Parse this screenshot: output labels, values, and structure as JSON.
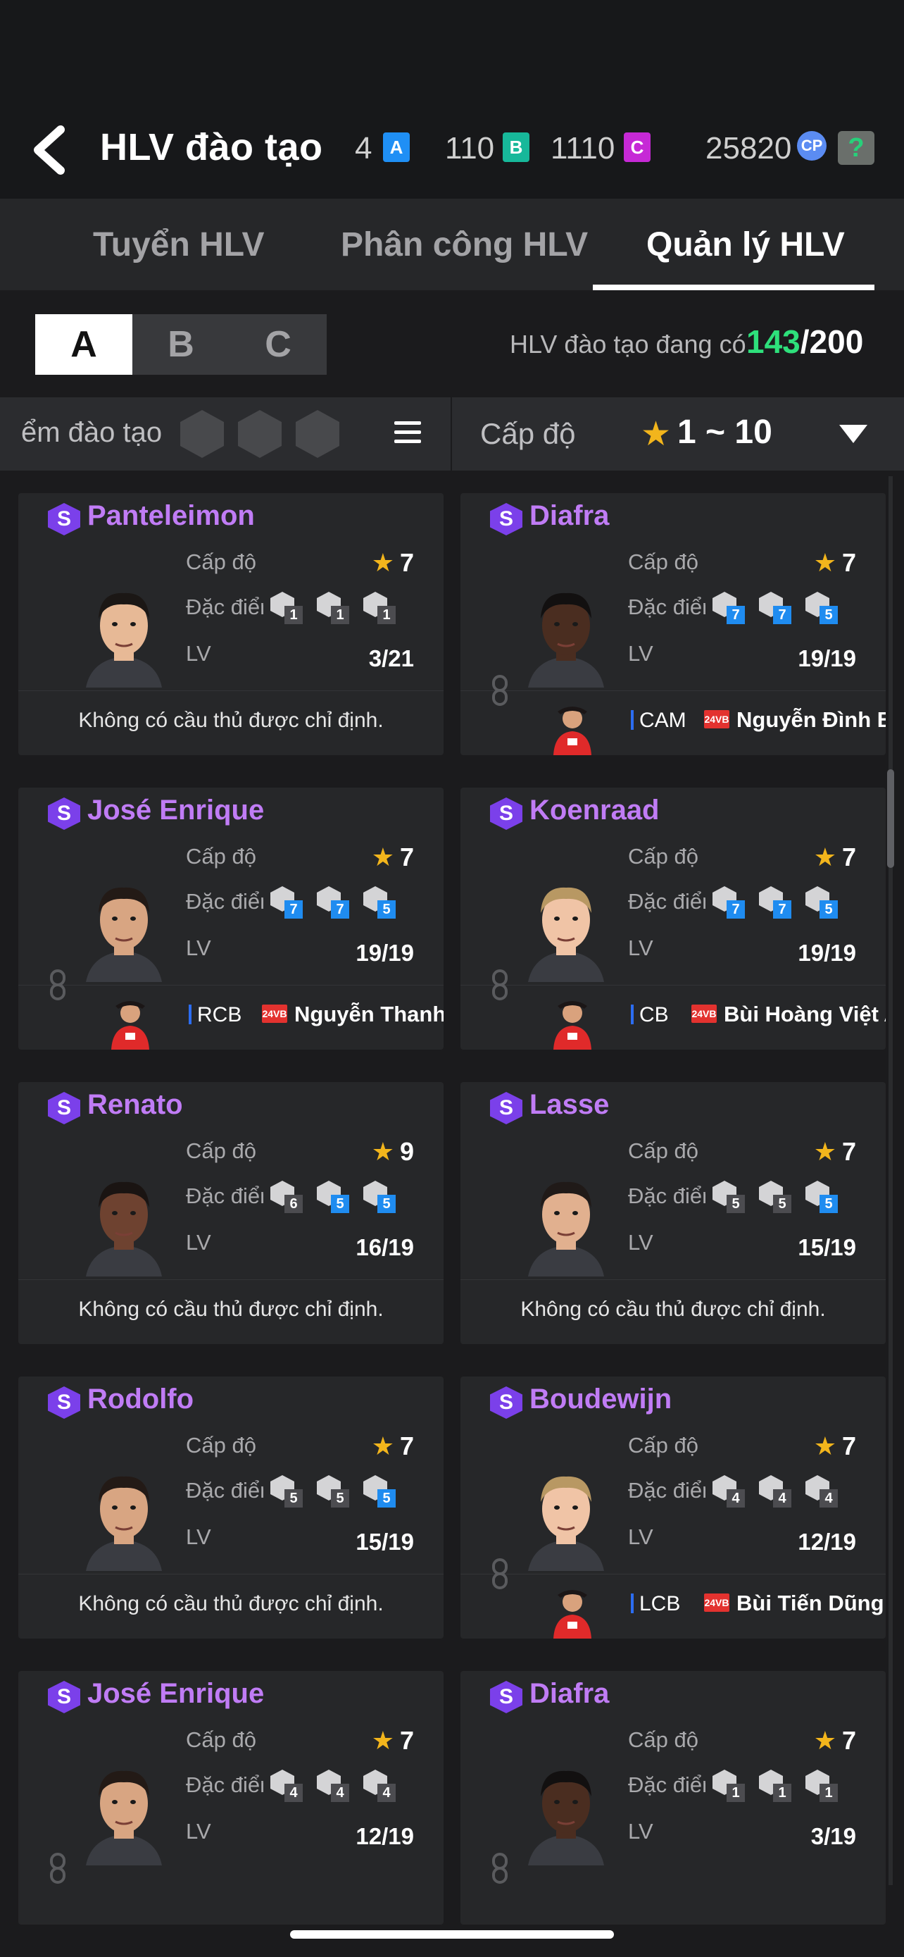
{
  "header": {
    "title": "HLV đào tạo",
    "currencies": [
      {
        "value": "4",
        "letter": "A",
        "color": "#1f8ff5"
      },
      {
        "value": "110",
        "letter": "B",
        "color": "#17b89a"
      },
      {
        "value": "1110",
        "letter": "C",
        "color": "#c629d6"
      }
    ],
    "cp_value": "25820",
    "cp_icon": "CP",
    "help_icon": "?"
  },
  "tabs": [
    {
      "label": "Tuyển HLV"
    },
    {
      "label": "Phân công HLV"
    },
    {
      "label": "Quản lý HLV",
      "active": true
    }
  ],
  "segments": [
    "A",
    "B",
    "C"
  ],
  "coach_count": {
    "label": "HLV đào tạo đang có",
    "current": "143",
    "max": "/200"
  },
  "filter": {
    "left_label": "ểm đào tạo",
    "level_label": "Cấp độ",
    "level_star": "★",
    "level_range": "1 ~ 10"
  },
  "labels": {
    "level": "Cấp độ",
    "trait": "Đặc điểm",
    "lv": "LV",
    "star": "★",
    "s": "S",
    "tag": "24VB"
  },
  "cards": [
    {
      "name": "Panteleimon",
      "level": "7",
      "lv": "3/21",
      "traits": [
        "1",
        "1",
        "1"
      ],
      "blue": [
        false,
        false,
        false
      ],
      "none": "Không có cầu thủ được chỉ định.",
      "skin": "#e7b996",
      "hair": "#1b1715"
    },
    {
      "name": "Diafra",
      "level": "7",
      "lv": "19/19",
      "traits": [
        "7",
        "7",
        "5"
      ],
      "blue": [
        true,
        true,
        true
      ],
      "pos": "CAM",
      "player": "Nguyễn Đình Bắc",
      "skin": "#4a2d20",
      "hair": "#121010"
    },
    {
      "name": "José Enrique",
      "level": "7",
      "lv": "19/19",
      "traits": [
        "7",
        "7",
        "5"
      ],
      "blue": [
        true,
        true,
        true
      ],
      "pos": "RCB",
      "player": "Nguyễn Thanh Bình",
      "skin": "#d8a582",
      "hair": "#231a16"
    },
    {
      "name": "Koenraad",
      "level": "7",
      "lv": "19/19",
      "traits": [
        "7",
        "7",
        "5"
      ],
      "blue": [
        true,
        true,
        true
      ],
      "pos": "CB",
      "player": "Bùi Hoàng Việt Anh",
      "skin": "#f0c4a6",
      "hair": "#b89863"
    },
    {
      "name": "Renato",
      "level": "9",
      "lv": "16/19",
      "traits": [
        "6",
        "5",
        "5"
      ],
      "blue": [
        false,
        true,
        true
      ],
      "none": "Không có cầu thủ được chỉ định.",
      "skin": "#6e4230",
      "hair": "#1a1412"
    },
    {
      "name": "Lasse",
      "level": "7",
      "lv": "15/19",
      "traits": [
        "5",
        "5",
        "5"
      ],
      "blue": [
        false,
        false,
        true
      ],
      "none": "Không có cầu thủ được chỉ định.",
      "skin": "#e1b08f",
      "hair": "#201a18"
    },
    {
      "name": "Rodolfo",
      "level": "7",
      "lv": "15/19",
      "traits": [
        "5",
        "5",
        "5"
      ],
      "blue": [
        false,
        false,
        true
      ],
      "none": "Không có cầu thủ được chỉ định.",
      "skin": "#d8a582",
      "hair": "#231a16"
    },
    {
      "name": "Boudewijn",
      "level": "7",
      "lv": "12/19",
      "traits": [
        "4",
        "4",
        "4"
      ],
      "blue": [
        false,
        false,
        false
      ],
      "pos": "LCB",
      "player": "Bùi Tiến Dũng",
      "skin": "#f0c4a6",
      "hair": "#b89863"
    },
    {
      "name": "José Enrique",
      "level": "7",
      "lv": "12/19",
      "traits": [
        "4",
        "4",
        "4"
      ],
      "blue": [
        false,
        false,
        false
      ],
      "skin": "#d8a582",
      "hair": "#231a16"
    },
    {
      "name": "Diafra",
      "level": "7",
      "lv": "3/19",
      "traits": [
        "1",
        "1",
        "1"
      ],
      "blue": [
        false,
        false,
        false
      ],
      "skin": "#4a2d20",
      "hair": "#121010"
    }
  ]
}
